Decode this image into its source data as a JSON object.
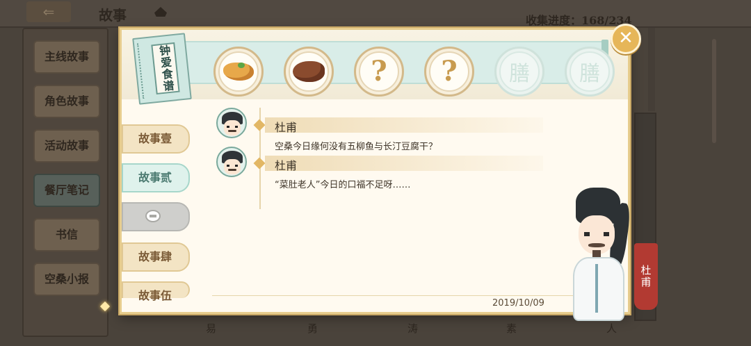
{
  "background": {
    "back_icon": "back-arrow-icon",
    "title": "故事",
    "collect_progress": "收集进度：168/234",
    "sidebar": [
      "主线故事",
      "角色故事",
      "活动故事",
      "餐厅笔记",
      "书信",
      "空桑小报"
    ],
    "sidebar_active_index": 3,
    "bottom_names": [
      "易",
      "勇",
      "涛",
      "素",
      "人"
    ]
  },
  "modal": {
    "book_title": "钟爱食谱",
    "dishes": [
      {
        "state": "unlocked",
        "icon": "dish-icon"
      },
      {
        "state": "unlocked",
        "icon": "roast-dish-icon"
      },
      {
        "state": "unknown",
        "label": "?"
      },
      {
        "state": "unknown",
        "label": "?"
      },
      {
        "state": "locked",
        "label": "膳"
      },
      {
        "state": "locked",
        "label": "膳"
      }
    ],
    "close_icon": "close-icon",
    "close_glyph": "✕",
    "tabs": [
      {
        "label": "故事壹",
        "state": "normal"
      },
      {
        "label": "故事贰",
        "state": "active"
      },
      {
        "label": "",
        "state": "locked"
      },
      {
        "label": "故事肆",
        "state": "normal"
      },
      {
        "label": "故事伍",
        "state": "normal"
      }
    ],
    "dialogues": [
      {
        "speaker": "杜甫",
        "text": "空桑今日缘何没有五柳鱼与长汀豆腐干？"
      },
      {
        "speaker": "杜甫",
        "text": "“菜肚老人”今日的口福不足呀……"
      }
    ],
    "date": "2019/10/09",
    "character_name": "杜甫"
  },
  "colors": {
    "modal_border": "#e7cd8e",
    "close_button": "#e6b659",
    "active_tab": "#dff2ec",
    "name_banner": "#b23a32"
  }
}
